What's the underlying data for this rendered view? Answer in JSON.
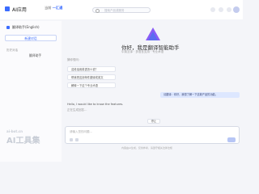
{
  "topbar": {
    "brand": "AI应用",
    "crumb_prefix": "当前",
    "crumb_link": "一汇通",
    "search_placeholder": "搜索产品或服务"
  },
  "sidebar": {
    "title": "翻译助手(English)",
    "new_chat": "新建对话",
    "section_label": "历史对话",
    "items": [
      {
        "label": "翻译助手"
      }
    ]
  },
  "watermark": {
    "small": "ai-bot.cn",
    "big": "AI工具集"
  },
  "main": {
    "hero_title": "你好，我是翻译智能助手",
    "hero_sub": "中英互译 · 多语言支持 · 专业术语",
    "suggest_label": "猜你想问：",
    "suggestions": [
      "这段话用英语怎么说？",
      "帮我把这封邮件翻译成英文",
      "解释一下这个专业术语"
    ],
    "user_message": "请翻译：你好，我想了解一下这款产品的功能。",
    "reply": "Hello, I would like to know the features.",
    "reply_sub": "正在生成回答…",
    "stop_label": "停止",
    "input_placeholder": "请输入您的问题...",
    "footer": "内容由AI生成，仅供参考，请遵守相关法律法规"
  },
  "colors": {
    "accent": "#3b6cff",
    "bubble": "#dde7ff",
    "background": "#f4f5f9"
  }
}
